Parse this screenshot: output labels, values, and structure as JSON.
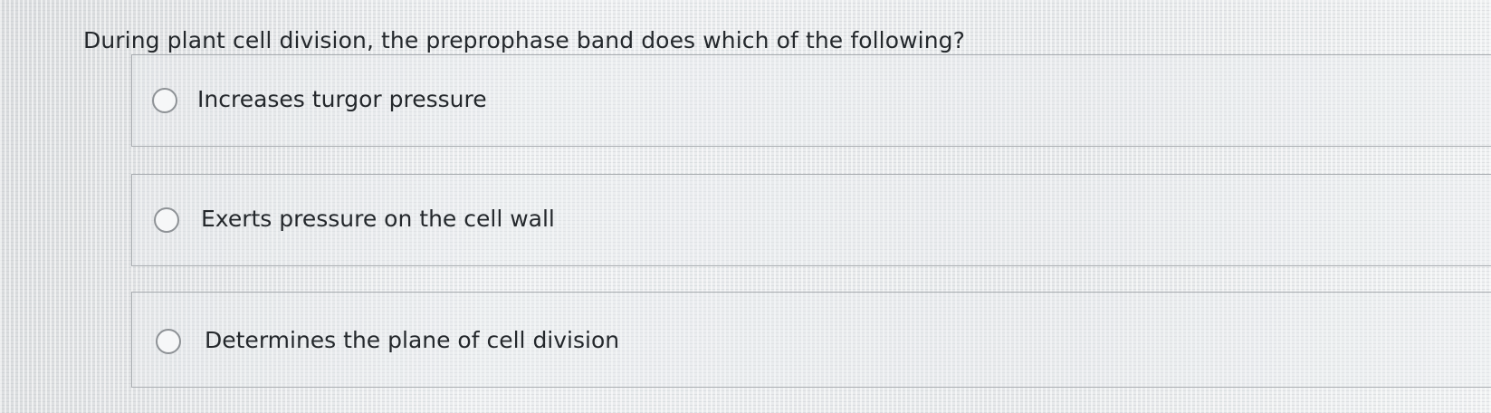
{
  "question": {
    "text": "During plant cell division, the preprophase band does which of the following?"
  },
  "options": [
    {
      "label": "Increases turgor pressure",
      "selected": false
    },
    {
      "label": "Exerts pressure on the cell wall",
      "selected": false
    },
    {
      "label": "Determines the plane of cell division",
      "selected": false
    }
  ]
}
